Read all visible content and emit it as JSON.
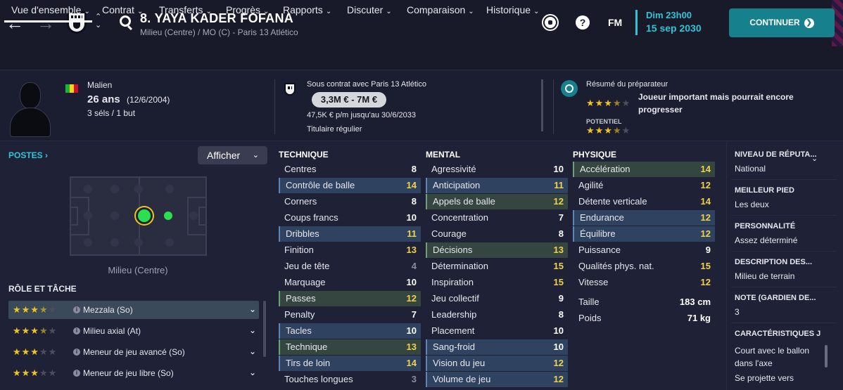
{
  "header": {
    "title": "8. YAYA KADER FOFANA",
    "subtitle": "Milieu (Centre) / MO (C) - Paris 13 Atlético",
    "date_day": "Dim 23h00",
    "date_full": "15 sep 2030",
    "continue_label": "CONTINUER",
    "fm_label": "FM",
    "help_label": "?"
  },
  "tabs": [
    "Vue d'ensemble",
    "Contrat",
    "Transferts",
    "Progrès",
    "Rapports",
    "Discuter",
    "Comparaison",
    "Historique"
  ],
  "profile": {
    "nationality": "Malien",
    "age": "26 ans",
    "birth": "(12/6/2004)",
    "caps": "3 séls / 1 but"
  },
  "contract": {
    "line": "Sous contrat avec Paris 13 Atlético",
    "value": "3,3M € - 7M €",
    "wage": "47,5K € p/m jusqu'au 30/6/2033",
    "status": "Titulaire régulier"
  },
  "scout": {
    "title": "Résumé du préparateur",
    "summary_line1": "Joueur important mais pourrait encore",
    "summary_line2": "progresser",
    "ability_stars": 3.5,
    "potential_label": "POTENTIEL",
    "potential_stars": 3.5
  },
  "positions": {
    "label": "POSTES",
    "show_label": "Afficher",
    "position_name": "Milieu (Centre)"
  },
  "roles": {
    "header": "RÔLE ET TÂCHE",
    "items": [
      {
        "name": "Mezzala (So)",
        "stars": 3.5
      },
      {
        "name": "Milieu axial (At)",
        "stars": 3.5
      },
      {
        "name": "Meneur de jeu avancé (So)",
        "stars": 3
      },
      {
        "name": "Meneur de jeu libre (So)",
        "stars": 3
      }
    ]
  },
  "attributes": {
    "technique": {
      "header": "TECHNIQUE",
      "rows": [
        {
          "name": "Centres",
          "value": "8",
          "hl": "",
          "color": "white"
        },
        {
          "name": "Contrôle de balle",
          "value": "14",
          "hl": "blue",
          "color": "yellow"
        },
        {
          "name": "Corners",
          "value": "8",
          "hl": "",
          "color": "white"
        },
        {
          "name": "Coups francs",
          "value": "10",
          "hl": "",
          "color": "white"
        },
        {
          "name": "Dribbles",
          "value": "11",
          "hl": "blue",
          "color": "yellow"
        },
        {
          "name": "Finition",
          "value": "13",
          "hl": "",
          "color": "yellow"
        },
        {
          "name": "Jeu de tête",
          "value": "4",
          "hl": "",
          "color": "grey"
        },
        {
          "name": "Marquage",
          "value": "10",
          "hl": "",
          "color": "white"
        },
        {
          "name": "Passes",
          "value": "12",
          "hl": "green",
          "color": "yellow"
        },
        {
          "name": "Penalty",
          "value": "7",
          "hl": "",
          "color": "white"
        },
        {
          "name": "Tacles",
          "value": "10",
          "hl": "blue",
          "color": "white"
        },
        {
          "name": "Technique",
          "value": "13",
          "hl": "green",
          "color": "yellow"
        },
        {
          "name": "Tirs de loin",
          "value": "14",
          "hl": "blue",
          "color": "yellow"
        },
        {
          "name": "Touches longues",
          "value": "3",
          "hl": "",
          "color": "grey"
        }
      ]
    },
    "mental": {
      "header": "MENTAL",
      "rows": [
        {
          "name": "Agressivité",
          "value": "10",
          "hl": "",
          "color": "white"
        },
        {
          "name": "Anticipation",
          "value": "11",
          "hl": "blue",
          "color": "yellow"
        },
        {
          "name": "Appels de balle",
          "value": "12",
          "hl": "green",
          "color": "yellow"
        },
        {
          "name": "Concentration",
          "value": "7",
          "hl": "",
          "color": "white"
        },
        {
          "name": "Courage",
          "value": "8",
          "hl": "",
          "color": "white"
        },
        {
          "name": "Décisions",
          "value": "13",
          "hl": "green",
          "color": "yellow"
        },
        {
          "name": "Détermination",
          "value": "15",
          "hl": "",
          "color": "yellow"
        },
        {
          "name": "Inspiration",
          "value": "15",
          "hl": "",
          "color": "yellow"
        },
        {
          "name": "Jeu collectif",
          "value": "9",
          "hl": "",
          "color": "white"
        },
        {
          "name": "Leadership",
          "value": "8",
          "hl": "",
          "color": "white"
        },
        {
          "name": "Placement",
          "value": "10",
          "hl": "",
          "color": "white"
        },
        {
          "name": "Sang-froid",
          "value": "10",
          "hl": "blue",
          "color": "white"
        },
        {
          "name": "Vision du jeu",
          "value": "12",
          "hl": "blue",
          "color": "yellow"
        },
        {
          "name": "Volume de jeu",
          "value": "12",
          "hl": "blue",
          "color": "yellow"
        }
      ]
    },
    "physique": {
      "header": "PHYSIQUE",
      "rows": [
        {
          "name": "Accélération",
          "value": "14",
          "hl": "green",
          "color": "yellow"
        },
        {
          "name": "Agilité",
          "value": "12",
          "hl": "",
          "color": "yellow"
        },
        {
          "name": "Détente verticale",
          "value": "14",
          "hl": "",
          "color": "yellow"
        },
        {
          "name": "Endurance",
          "value": "12",
          "hl": "blue",
          "color": "yellow"
        },
        {
          "name": "Équilibre",
          "value": "12",
          "hl": "blue",
          "color": "yellow"
        },
        {
          "name": "Puissance",
          "value": "9",
          "hl": "",
          "color": "white"
        },
        {
          "name": "Qualités phys. nat.",
          "value": "15",
          "hl": "",
          "color": "yellow"
        },
        {
          "name": "Vitesse",
          "value": "12",
          "hl": "",
          "color": "yellow"
        }
      ],
      "extra": [
        {
          "name": "Taille",
          "value": "183 cm"
        },
        {
          "name": "Poids",
          "value": "71 kg"
        }
      ]
    }
  },
  "side_info": [
    {
      "head": "NIVEAU DE RÉPUTA...",
      "value": "National"
    },
    {
      "head": "MEILLEUR PIED",
      "value": "Les deux"
    },
    {
      "head": "PERSONNALITÉ",
      "value": "Assez déterminé"
    },
    {
      "head": "DESCRIPTION DES...",
      "value": "Milieu de terrain"
    },
    {
      "head": "NOTE (GARDIEN DE...",
      "value": "3"
    },
    {
      "head": "CARACTÉRISTIQUES J",
      "value": "Court avec le ballon"
    }
  ],
  "side_extra": [
    "dans l'axe",
    "Se projette vers"
  ],
  "colors": {
    "accent": "#2fc4d6",
    "button": "#16808d",
    "star": "#f0c419"
  }
}
